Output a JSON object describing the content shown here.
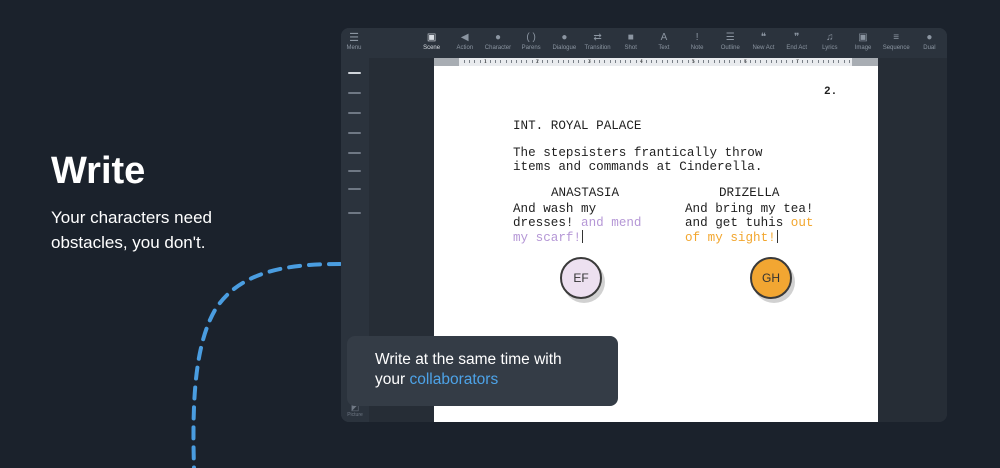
{
  "hero": {
    "title": "Write",
    "subtitle": "Your characters need obstacles, you don't."
  },
  "toolbar": {
    "menu_label": "Menu",
    "tools": [
      {
        "label": "Scene",
        "icon": "image-icon",
        "glyph": "▣",
        "active": true
      },
      {
        "label": "Action",
        "icon": "megaphone-icon",
        "glyph": "◀",
        "active": false
      },
      {
        "label": "Character",
        "icon": "person-icon",
        "glyph": "●",
        "active": false
      },
      {
        "label": "Parens",
        "icon": "parens-icon",
        "glyph": "( )",
        "active": false
      },
      {
        "label": "Dialogue",
        "icon": "speech-bubble-icon",
        "glyph": "●",
        "active": false
      },
      {
        "label": "Transition",
        "icon": "transition-arrows-icon",
        "glyph": "⇄",
        "active": false
      },
      {
        "label": "Shot",
        "icon": "camera-icon",
        "glyph": "■",
        "active": false
      },
      {
        "label": "Text",
        "icon": "text-icon",
        "glyph": "A",
        "active": false
      },
      {
        "label": "Note",
        "icon": "exclamation-icon",
        "glyph": "!",
        "active": false
      },
      {
        "label": "Outline",
        "icon": "outline-icon",
        "glyph": "☰",
        "active": false
      },
      {
        "label": "New Act",
        "icon": "quote-open-icon",
        "glyph": "❝",
        "active": false
      },
      {
        "label": "End Act",
        "icon": "quote-close-icon",
        "glyph": "❞",
        "active": false
      },
      {
        "label": "Lyrics",
        "icon": "music-note-icon",
        "glyph": "♫",
        "active": false
      },
      {
        "label": "Image",
        "icon": "picture-icon",
        "glyph": "▣",
        "active": false
      },
      {
        "label": "Sequence",
        "icon": "sequence-icon",
        "glyph": "≡",
        "active": false
      },
      {
        "label": "Dual",
        "icon": "dual-bubble-icon",
        "glyph": "●",
        "active": false
      }
    ]
  },
  "sidebar": {
    "bottom_label": "Picture"
  },
  "ruler": {
    "numbers": [
      "1",
      "2",
      "3",
      "4",
      "5",
      "6",
      "7"
    ]
  },
  "script": {
    "page_number": "2.",
    "scene_heading": "INT. ROYAL PALACE",
    "action": "The stepsisters frantically throw\nitems and commands at Cinderella.",
    "left": {
      "character": "ANASTASIA",
      "dialogue_line1": "And wash my",
      "dialogue_line2_typed": "dresses!",
      "dialogue_line2_pending": " and mend",
      "dialogue_line3_pending": "my scarf!"
    },
    "right": {
      "character": "DRIZELLA",
      "dialogue_line1": "And bring my tea!",
      "dialogue_line2_typed": "and get tuhis",
      "dialogue_line2_pending": " out",
      "dialogue_line3_pending": "of my sight!"
    }
  },
  "collaborators": {
    "ef": {
      "initials": "EF",
      "color": "#ede0f0"
    },
    "gh": {
      "initials": "GH",
      "color": "#f2a632"
    }
  },
  "tooltip": {
    "line1": "Write at the same time with",
    "line2_prefix": "your ",
    "line2_link": "collaborators"
  },
  "colors": {
    "background": "#1b222c",
    "app_chrome": "#2b333d",
    "accent_blue": "#4da3e8",
    "collab_purple": "#b597d6",
    "collab_orange": "#f2a62e"
  }
}
